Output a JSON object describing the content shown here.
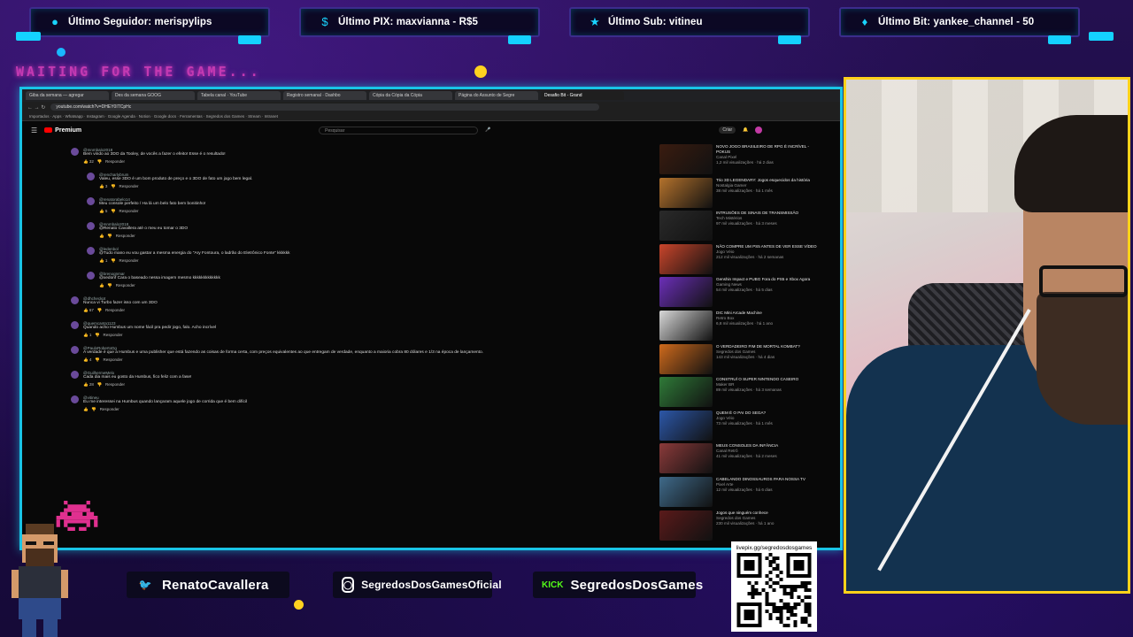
{
  "alerts": [
    {
      "icon": "user-icon",
      "text": "Último Seguidor: merispylips"
    },
    {
      "icon": "dollar-icon",
      "text": "Último PIX: maxvianna - R$5"
    },
    {
      "icon": "star-icon",
      "text": "Último Sub: vitineu"
    },
    {
      "icon": "diamond-icon",
      "text": "Último Bit: yankee_channel - 50"
    }
  ],
  "waiting_text": "WAITING FOR THE GAME...",
  "browser": {
    "tabs": [
      "Giba da semana — agregar",
      "Des da semana GOOG",
      "Tabela canal · YouTube",
      "Registro semanal · Dashbo",
      "Cópia da Cópia da Cópia",
      "Página do Assunto de Segre",
      "Desafio Bit - Grand"
    ],
    "url": "youtube.com/watch?v=DHEY0ITCpHc",
    "bookmarks": "Importados · Apps · Whatsapp · Instagram · Google Agenda · Notion · Google docs · Ferramentas · Segredos dos Games · Stream · Intranet",
    "yt_logo": "Premium",
    "search_placeholder": "Pesquisar",
    "create_label": "Criar"
  },
  "comments": [
    {
      "user": "@mnmbalo2018",
      "text": "Bem vindo ao 3DO da Tooley, de vocês a fazer o efeito! Esse é o resultado!",
      "likes": "32",
      "reply": "Responder"
    },
    {
      "user": "@rencharlybrum",
      "text": "Valeu, esse 3DO é um bom produto de preço e o 3DO de fato um jogo bem legal.",
      "likes": "3",
      "reply": "Responder"
    },
    {
      "user": "@renatorabelo14",
      "text": "Meu console perfeito / Ha lá um belo fato bem bonitinho!",
      "likes": "5",
      "reply": "Responder"
    },
    {
      "user": "@mnmbalo2018",
      "text": "@Renato Cavallera até o meu eu tomar o 3DO",
      "likes": "",
      "reply": "Responder"
    },
    {
      "user": "@ledenbol",
      "text": "@Tudo mano eu vou gastar a mesma energia do \"Ary Fontoura, o ladrão do Eletrônico Fonte\" kkkkkk",
      "likes": "1",
      "reply": "Responder"
    },
    {
      "user": "@brenognmar",
      "text": "@xedonf Cara o baseado nessa imagem mesmo kkkkkkkkkkkkk",
      "likes": "",
      "reply": "Responder"
    },
    {
      "user": "@dhcheckpt",
      "text": "Nunca vi Turbo fazer isso com um 3DO",
      "likes": "67",
      "reply": "Responder"
    },
    {
      "user": "@quemcanta1123",
      "text": "Quando acho Humbus um nome fácil pra pedir jogo, falo. Acho incrível",
      "likes": "1",
      "reply": "Responder"
    },
    {
      "user": "@PauloRobertoDg",
      "text": "A verdade é que a Humbus e uma publisher que está fazendo as coisas de forma certa, com preços equivalentes ao que entregam de verdade, enquanto a maioria cobra 80 dólares e 1/3 na época de lançamento.",
      "likes": "4",
      "reply": "Responder"
    },
    {
      "user": "@GuilhermeMelo",
      "text": "Cada dia mais eu gosto da Humbus, fico feliz com a fase!",
      "likes": "28",
      "reply": "Responder"
    },
    {
      "user": "@vitineu",
      "text": "Eu me interessei na Humbus quando lançaram aquele jogo de corrida que é bem difícil",
      "likes": "",
      "reply": "Responder"
    }
  ],
  "sidebar_videos": [
    {
      "title": "NOVO JOGO BRASILEIRO DE RPG É INCRÍVEL - POKUS",
      "channel": "Canal Pixel",
      "stats": "1,2 mil visualizações · há 2 dias"
    },
    {
      "title": "Trio 3D LEGENDARY: Jogos esquecidos da história",
      "channel": "Nostalgia Gamer",
      "stats": "38 mil visualizações · há 1 mês"
    },
    {
      "title": "INTRUSÕES DE SINAIS DE TRANSMISSÃO",
      "channel": "Tech Mistérios",
      "stats": "97 mil visualizações · há 3 meses"
    },
    {
      "title": "NÃO COMPRE UM PS5 ANTES DE VER ESSE VÍDEO",
      "channel": "Jogo Véio",
      "stats": "212 mil visualizações · há 2 semanas"
    },
    {
      "title": "Genshin Impact e PUBG Fora do PS5 e Xbox Agora",
      "channel": "Gaming News",
      "stats": "54 mil visualizações · há 5 dias"
    },
    {
      "title": "DIC Mini Arcade Machine",
      "channel": "Retro Box",
      "stats": "6,8 mil visualizações · há 1 ano"
    },
    {
      "title": "O VERDADEIRO FIM DE MORTAL KOMBAT?",
      "channel": "Segredos dos Games",
      "stats": "143 mil visualizações · há 4 dias"
    },
    {
      "title": "CONSTRUÍ O SUPER NINTENDO CASEIRO",
      "channel": "Maker BR",
      "stats": "89 mil visualizações · há 3 semanas"
    },
    {
      "title": "QUEM É O PAI DO SEGA?",
      "channel": "Jogo Véio",
      "stats": "73 mil visualizações · há 1 mês"
    },
    {
      "title": "MEUS CONSOLES DA INFÂNCIA",
      "channel": "Canal Retrô",
      "stats": "41 mil visualizações · há 2 meses"
    },
    {
      "title": "CABELANDO DINOSSAUROS PARA NOSSA TV",
      "channel": "Pixel Arte",
      "stats": "12 mil visualizações · há 6 dias"
    },
    {
      "title": "Jogos que ninguém conhece",
      "channel": "Segredos dos Games",
      "stats": "230 mil visualizações · há 1 ano"
    }
  ],
  "socials": [
    {
      "icon": "twitter-icon",
      "handle": "RenatoCavallera"
    },
    {
      "icon": "instagram-icon",
      "handle": "SegredosDosGamesOficial"
    },
    {
      "icon": "kick-icon",
      "handle": "SegredosDosGames"
    }
  ],
  "qr_label": "livepix.gg/segredosdosgames",
  "colors": {
    "accent": "#19c4e6",
    "cam_border": "#ffd11a",
    "twitter": "#1da1f2",
    "kick": "#53fc18",
    "alert_icon": "#19d3ff"
  }
}
